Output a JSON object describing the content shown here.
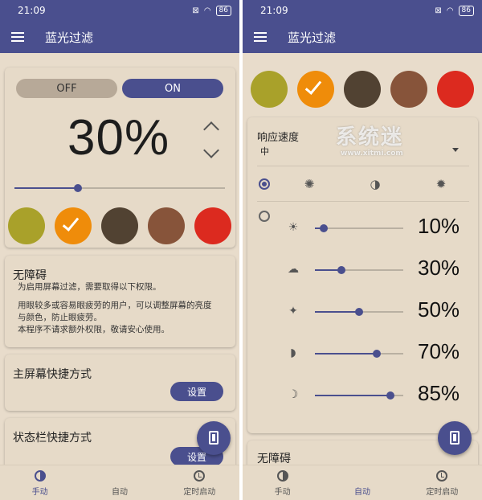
{
  "status": {
    "time": "21:09",
    "battery": "86"
  },
  "app_title": "蓝光过滤",
  "screen_a": {
    "toggle_off": "OFF",
    "toggle_on": "ON",
    "intensity": "30%",
    "intensity_value": 0.3,
    "swatches": [
      {
        "color": "#a9a12a",
        "selected": false
      },
      {
        "color": "#ef8c0a",
        "selected": true
      },
      {
        "color": "#514232",
        "selected": false
      },
      {
        "color": "#87543a",
        "selected": false
      },
      {
        "color": "#dc2a1f",
        "selected": false
      }
    ],
    "accessibility": {
      "title": "无障碍",
      "line1": "为启用屏幕过滤，需要取得以下权限。",
      "line2": "用眼较多或容易眼疲劳的用户，可以调整屏幕的亮度",
      "line3": "与颜色，防止眼疲劳。",
      "line4": "本程序不请求额外权限，敬请安心使用。"
    },
    "home_shortcut": {
      "title": "主屏幕快捷方式",
      "button": "设置"
    },
    "statusbar_shortcut": {
      "title": "状态栏快捷方式",
      "button": "设置"
    }
  },
  "screen_b": {
    "swatches": [
      {
        "color": "#a9a12a",
        "selected": false
      },
      {
        "color": "#ef8c0a",
        "selected": true
      },
      {
        "color": "#514232",
        "selected": false
      },
      {
        "color": "#87543a",
        "selected": false
      },
      {
        "color": "#dc2a1f",
        "selected": false
      }
    ],
    "response_speed_label": "响应速度",
    "response_speed_value": "中",
    "watermark_main": "系统迷",
    "watermark_sub": "www.xitmi.com",
    "rows": [
      {
        "icon": "sun-icon",
        "pct": "10%",
        "value": 0.1
      },
      {
        "icon": "cloud-icon",
        "pct": "30%",
        "value": 0.3
      },
      {
        "icon": "lamp-icon",
        "pct": "50%",
        "value": 0.5
      },
      {
        "icon": "moon-icon",
        "pct": "70%",
        "value": 0.7
      },
      {
        "icon": "crescent-icon",
        "pct": "85%",
        "value": 0.85
      }
    ],
    "accessibility_title": "无障碍"
  },
  "nav": {
    "manual": "手动",
    "auto": "自动",
    "timer": "定时启动",
    "auto_badge": "A"
  },
  "colors": {
    "accent": "#4a4f8e",
    "background": "#e8dccb"
  }
}
